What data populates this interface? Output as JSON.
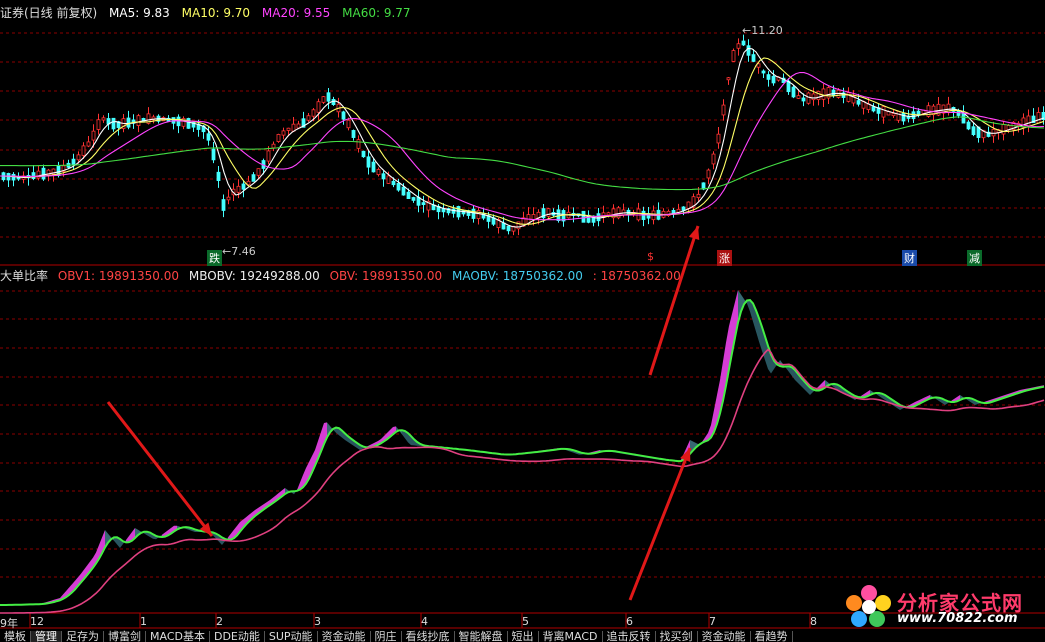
{
  "upper_header": {
    "title": "证券(日线 前复权)",
    "ma5": "MA5: 9.83",
    "ma10": "MA10: 9.70",
    "ma20": "MA20: 9.55",
    "ma60": "MA60: 9.77",
    "colors": {
      "ma5": "#ffffff",
      "ma10": "#ffff66",
      "ma20": "#ff44ff",
      "ma60": "#44dd44"
    }
  },
  "lower_header": {
    "title": "大单比率",
    "obv1": "OBV1: 19891350.00",
    "mbobv": "MBOBV: 19249288.00",
    "obv": "OBV: 19891350.00",
    "maobv": "MAOBV: 18750362.00",
    "extra": ": 18750362.00"
  },
  "price_labels": {
    "high": "11.20",
    "low": "7.46"
  },
  "markers": [
    {
      "text": "跌",
      "color": "#ffffff",
      "bg": "#0a6a2a"
    },
    {
      "text": "$",
      "color": "#ff3333",
      "bg": "transparent"
    },
    {
      "text": "涨",
      "color": "#ffffff",
      "bg": "#aa1111"
    },
    {
      "text": "财",
      "color": "#ffffff",
      "bg": "#1a4aa8"
    },
    {
      "text": "减",
      "color": "#ffffff",
      "bg": "#0a6a2a"
    }
  ],
  "time_axis": [
    "9年",
    "12",
    "1",
    "2",
    "3",
    "4",
    "5",
    "6",
    "7",
    "8"
  ],
  "bottom_tabs": [
    "模板",
    "管理",
    "足存为",
    "博富剑",
    "MACD基本",
    "DDE动能",
    "SUP动能",
    "资金动能",
    "阴庄",
    "看线抄底",
    "智能解盘",
    "短出",
    "背离MACD",
    "追击反转",
    "找买剑",
    "资金动能",
    "看趋势"
  ],
  "logo": {
    "name": "分析家公式网",
    "url": "www.70822.com"
  },
  "colors": {
    "up": "#ff3333",
    "down": "#44ffff",
    "grid": "#8b0000",
    "obv_up": "#e040e0",
    "obv_down": "#3a6e78",
    "obv_ma_up": "#44ee44",
    "obv_ma": "#e04080",
    "arrow": "#e01818"
  }
}
